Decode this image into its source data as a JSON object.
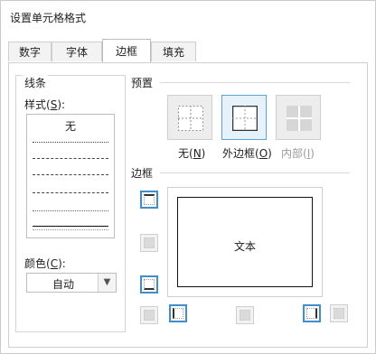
{
  "window": {
    "title": "设置单元格格式"
  },
  "tabs": [
    {
      "label": "数字"
    },
    {
      "label": "字体"
    },
    {
      "label": "边框"
    },
    {
      "label": "填充"
    }
  ],
  "line_group": {
    "title": "线条",
    "style_label": "样式(S):",
    "style_none": "无",
    "color_label": "颜色(C):",
    "color_value": "自动"
  },
  "presets": {
    "title": "预置",
    "none_label": "无(N)",
    "outline_label": "外边框(O)",
    "inside_label": "内部(I)"
  },
  "border": {
    "title": "边框",
    "preview_text": "文本"
  },
  "colors": {
    "accent": "#3f8fd0",
    "selected_bg": "#e6f2fb"
  },
  "icons": [
    "none-border-icon",
    "outline-border-icon",
    "inside-border-icon",
    "top-border-icon",
    "middle-horizontal-border-icon",
    "bottom-border-icon",
    "diagonal-up-border-icon",
    "left-border-icon",
    "middle-vertical-border-icon",
    "right-border-icon",
    "diagonal-down-border-icon",
    "chevron-down-icon"
  ]
}
